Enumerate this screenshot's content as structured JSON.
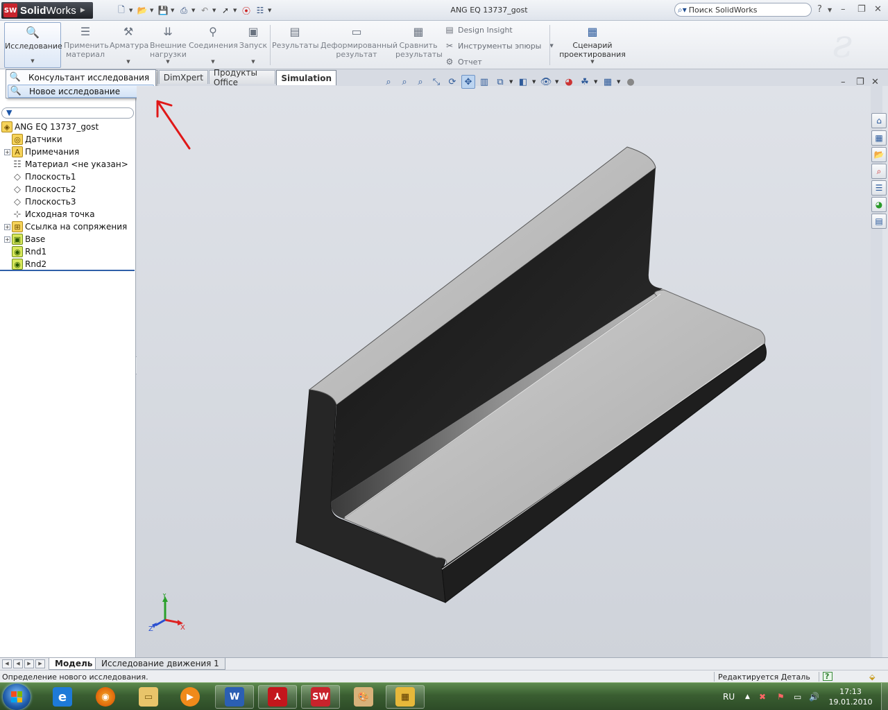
{
  "app": {
    "name_bold": "Solid",
    "name_regular": "Works",
    "logo_mark": "SW",
    "window_title": "ANG EQ 13737_gost",
    "search_placeholder": "Поиск SolidWorks"
  },
  "ribbon": {
    "study": "Исследование",
    "apply_material": [
      "Применить",
      "материал"
    ],
    "fixtures": "Арматура",
    "external_loads": [
      "Внешние",
      "нагрузки"
    ],
    "connections": "Соединения",
    "run": "Запуск",
    "results": "Результаты",
    "deformed_result": [
      "Деформированный",
      "результат"
    ],
    "compare_results": [
      "Сравнить",
      "результаты"
    ],
    "design_insight": "Design Insight",
    "plot_tools": "Инструменты эпюры",
    "report": "Отчет",
    "design_scenario": [
      "Сценарий",
      "проектирования"
    ]
  },
  "menu": {
    "items": [
      {
        "label": "Консультант исследования",
        "icon": "study-advisor-icon"
      },
      {
        "label": "Новое исследование",
        "icon": "new-study-icon",
        "highlighted": true
      }
    ]
  },
  "command_tabs": [
    {
      "label": "DimXpert",
      "active": false
    },
    {
      "label": "Продукты Office",
      "active": false
    },
    {
      "label": "Simulation",
      "active": true
    }
  ],
  "tree": {
    "root": "ANG EQ 13737_gost",
    "items": [
      {
        "label": "Датчики",
        "icon": "sensors-icon",
        "expandable": false
      },
      {
        "label": "Примечания",
        "icon": "annotations-icon",
        "expandable": true
      },
      {
        "label": "Материал <не указан>",
        "icon": "material-icon",
        "expandable": false
      },
      {
        "label": "Плоскость1",
        "icon": "plane-icon",
        "expandable": false
      },
      {
        "label": "Плоскость2",
        "icon": "plane-icon",
        "expandable": false
      },
      {
        "label": "Плоскость3",
        "icon": "plane-icon",
        "expandable": false
      },
      {
        "label": "Исходная точка",
        "icon": "origin-icon",
        "expandable": false
      },
      {
        "label": "Ссылка на сопряжения",
        "icon": "mate-reference-icon",
        "expandable": true
      },
      {
        "label": "Base",
        "icon": "base-feature-icon",
        "expandable": true
      },
      {
        "label": "Rnd1",
        "icon": "fillet-icon",
        "expandable": false
      },
      {
        "label": "Rnd2",
        "icon": "fillet-icon",
        "expandable": false
      }
    ]
  },
  "triad": {
    "x": "X",
    "y": "Y",
    "z": "Z"
  },
  "bottom_tabs": [
    {
      "label": "Модель",
      "active": true
    },
    {
      "label": "Исследование движения 1",
      "active": false
    }
  ],
  "status": {
    "message": "Определение нового исследования.",
    "mode": "Редактируется Деталь",
    "help": "?"
  },
  "taskbar": {
    "language": "RU",
    "time": "17:13",
    "date": "19.01.2010",
    "apps": [
      "internet-explorer-icon",
      "firefox-icon",
      "explorer-icon",
      "media-player-icon",
      "word-icon",
      "acrobat-icon",
      "solidworks-icon",
      "paint-icon",
      "movie-maker-icon"
    ]
  },
  "colors": {
    "accent": "#2f5fa8",
    "model_top": "#c4c4c4",
    "model_side": "#2a2a2a",
    "arrow": "#e01818"
  }
}
